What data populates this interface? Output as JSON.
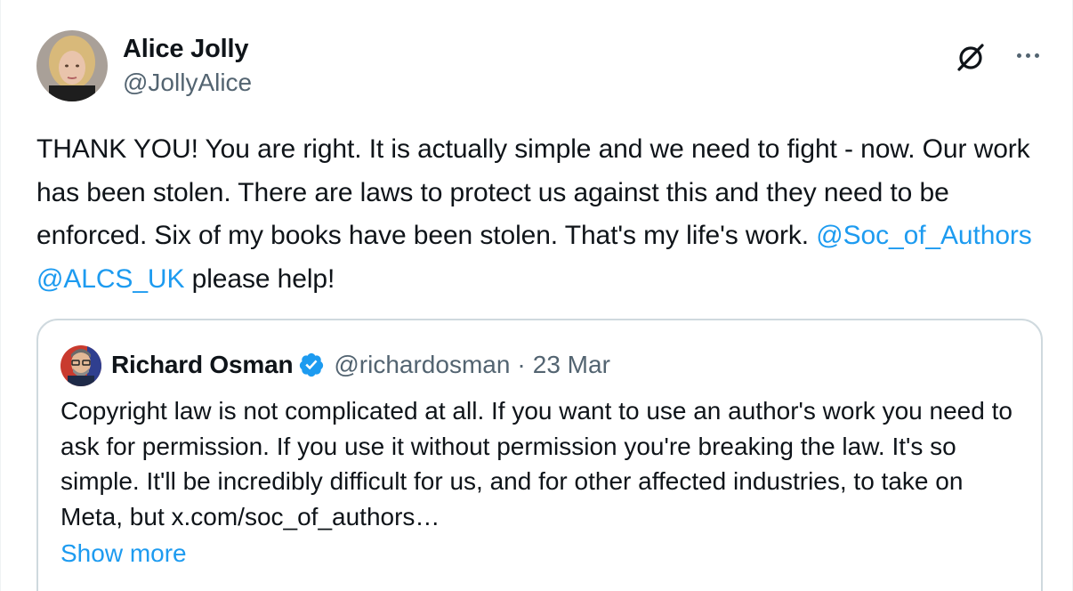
{
  "author": {
    "name": "Alice Jolly",
    "handle": "@JollyAlice"
  },
  "header_icons": [
    "grok-icon",
    "more-icon"
  ],
  "tweet": {
    "text_before": "THANK YOU! You are right. It is actually simple and we need to fight - now. Our work has been stolen. There are laws to protect us against this and they need to be enforced. Six of my books have been stolen. That's my life's work. ",
    "mentions": [
      "@Soc_of_Authors",
      "@ALCS_UK"
    ],
    "text_after": " please help!"
  },
  "quote": {
    "name": "Richard Osman",
    "verified": true,
    "handle": "@richardosman",
    "separator": "·",
    "date": "23 Mar",
    "text": "Copyright law is not complicated at all. If you want to use an author's work you need to ask for permission. If you use it without permission you're breaking the law. It's so simple. It'll be incredibly difficult for us, and for other affected industries, to take on Meta, but x.com/soc_of_authors…",
    "show_more": "Show more"
  },
  "colors": {
    "accent": "#1d9bf0",
    "text": "#0f1419",
    "secondary": "#536471",
    "border": "#cfd9de"
  }
}
